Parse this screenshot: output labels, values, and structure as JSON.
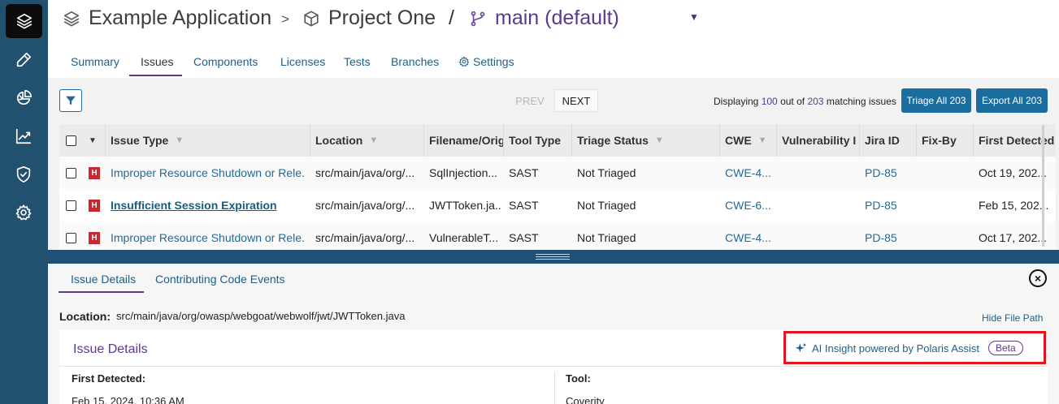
{
  "rail": {
    "items": [
      {
        "name": "layers-icon",
        "active": true
      },
      {
        "name": "ruler-pencil-icon",
        "active": false
      },
      {
        "name": "pie-chart-icon",
        "active": false
      },
      {
        "name": "trend-chart-icon",
        "active": false
      },
      {
        "name": "shield-check-icon",
        "active": false
      },
      {
        "name": "gear-icon",
        "active": false
      }
    ]
  },
  "breadcrumb": {
    "app": "Example Application",
    "sep1": ">",
    "project": "Project One",
    "sep2": "/",
    "branch": "main (default)",
    "caret": "▼"
  },
  "tabs": {
    "summary": "Summary",
    "issues": "Issues",
    "components": "Components",
    "licenses": "Licenses",
    "tests": "Tests",
    "branches": "Branches",
    "settings": "Settings"
  },
  "toolbar": {
    "prev": "PREV",
    "next": "NEXT",
    "display_prefix": "Displaying",
    "display_shown": "100",
    "display_mid": "out of",
    "display_total": "203",
    "display_suffix": "matching issues",
    "triage_all": "Triage All 203",
    "export_all": "Export All 203"
  },
  "table": {
    "columns": {
      "issue_type": "Issue Type",
      "location": "Location",
      "filename": "Filename/Orig",
      "tool_type": "Tool Type",
      "triage_status": "Triage Status",
      "cwe": "CWE",
      "vulnerability": "Vulnerability I",
      "jira": "Jira ID",
      "fix_by": "Fix-By",
      "first_detected": "First Detected"
    },
    "rows": [
      {
        "severity": "H",
        "issue": "Improper Resource Shutdown or Rele...",
        "location": "src/main/java/org/...",
        "filename": "SqlInjection...",
        "tool": "SAST",
        "triage": "Not Triaged",
        "cwe": "CWE-4...",
        "jira": "PD-85",
        "first_detected": "Oct 19, 202..."
      },
      {
        "severity": "H",
        "issue": "Insufficient Session Expiration",
        "location": "src/main/java/org/...",
        "filename": "JWTToken.ja...",
        "tool": "SAST",
        "triage": "Not Triaged",
        "cwe": "CWE-6...",
        "jira": "PD-85",
        "first_detected": "Feb 15, 202..."
      },
      {
        "severity": "H",
        "issue": "Improper Resource Shutdown or Rele...",
        "location": "src/main/java/org/...",
        "filename": "VulnerableT...",
        "tool": "SAST",
        "triage": "Not Triaged",
        "cwe": "CWE-4...",
        "jira": "PD-85",
        "first_detected": "Oct 17, 202..."
      }
    ]
  },
  "details": {
    "tab_issue_details": "Issue Details",
    "tab_code_events": "Contributing Code Events",
    "close": "×",
    "location_label": "Location:",
    "location_value": "src/main/java/org/owasp/webgoat/webwolf/jwt/JWTToken.java",
    "hide_path": "Hide File Path",
    "card_title": "Issue Details",
    "ai_insight": "AI Insight powered by Polaris Assist",
    "beta": "Beta",
    "first_detected_label": "First Detected:",
    "first_detected_value": "Feb 15, 2024, 10:36 AM",
    "tool_label": "Tool:",
    "tool_value": "Coverity"
  }
}
